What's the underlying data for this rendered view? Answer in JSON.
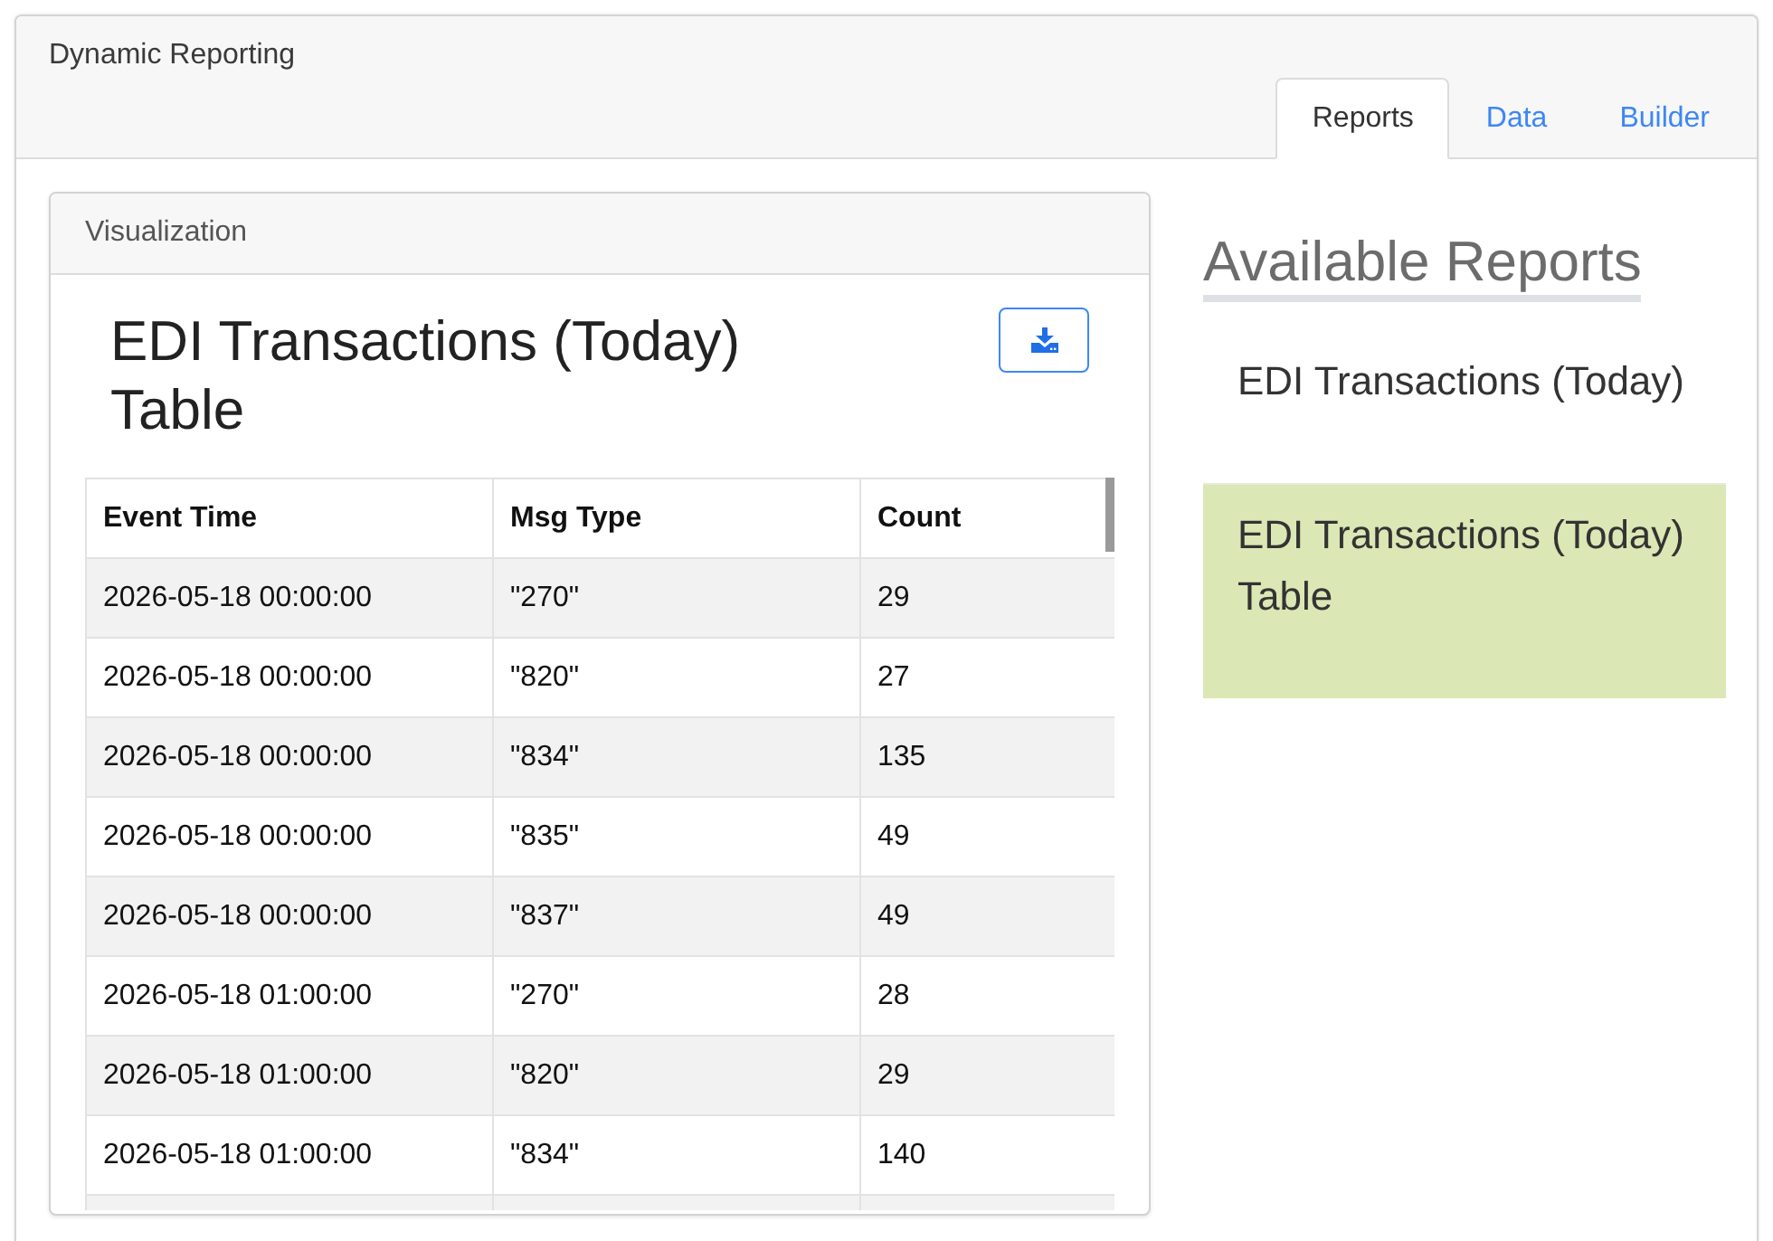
{
  "app": {
    "title": "Dynamic Reporting"
  },
  "tabs": [
    {
      "label": "Reports",
      "selected": true
    },
    {
      "label": "Data",
      "selected": false
    },
    {
      "label": "Builder",
      "selected": false
    }
  ],
  "visualization": {
    "panel_title": "Visualization",
    "report_title": "EDI Transactions (Today) Table",
    "table": {
      "columns": [
        "Event Time",
        "Msg Type",
        "Count"
      ],
      "rows": [
        [
          "2026-05-18 00:00:00",
          "\"270\"",
          "29"
        ],
        [
          "2026-05-18 00:00:00",
          "\"820\"",
          "27"
        ],
        [
          "2026-05-18 00:00:00",
          "\"834\"",
          "135"
        ],
        [
          "2026-05-18 00:00:00",
          "\"835\"",
          "49"
        ],
        [
          "2026-05-18 00:00:00",
          "\"837\"",
          "49"
        ],
        [
          "2026-05-18 01:00:00",
          "\"270\"",
          "28"
        ],
        [
          "2026-05-18 01:00:00",
          "\"820\"",
          "29"
        ],
        [
          "2026-05-18 01:00:00",
          "\"834\"",
          "140"
        ]
      ]
    }
  },
  "available_reports": {
    "heading": "Available Reports",
    "items": [
      {
        "label": "EDI Transactions (Today)",
        "selected": false
      },
      {
        "label": "EDI Transactions (Today) Table",
        "selected": true
      }
    ]
  }
}
